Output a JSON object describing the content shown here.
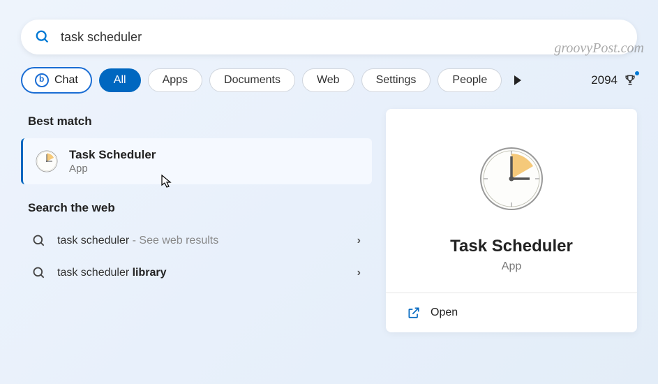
{
  "watermark": "groovyPost.com",
  "search": {
    "query": "task scheduler",
    "placeholder": ""
  },
  "filters": {
    "chat": "Chat",
    "all": "All",
    "apps": "Apps",
    "documents": "Documents",
    "web": "Web",
    "settings": "Settings",
    "people": "People"
  },
  "rewards": {
    "points": "2094"
  },
  "sections": {
    "best_match": "Best match",
    "search_web": "Search the web"
  },
  "result": {
    "title": "Task Scheduler",
    "subtitle": "App"
  },
  "web_results": [
    {
      "term": "task scheduler",
      "hint": " - See web results",
      "bold": ""
    },
    {
      "term": "task scheduler ",
      "hint": "",
      "bold": "library"
    }
  ],
  "detail": {
    "title": "Task Scheduler",
    "subtitle": "App",
    "open": "Open"
  }
}
